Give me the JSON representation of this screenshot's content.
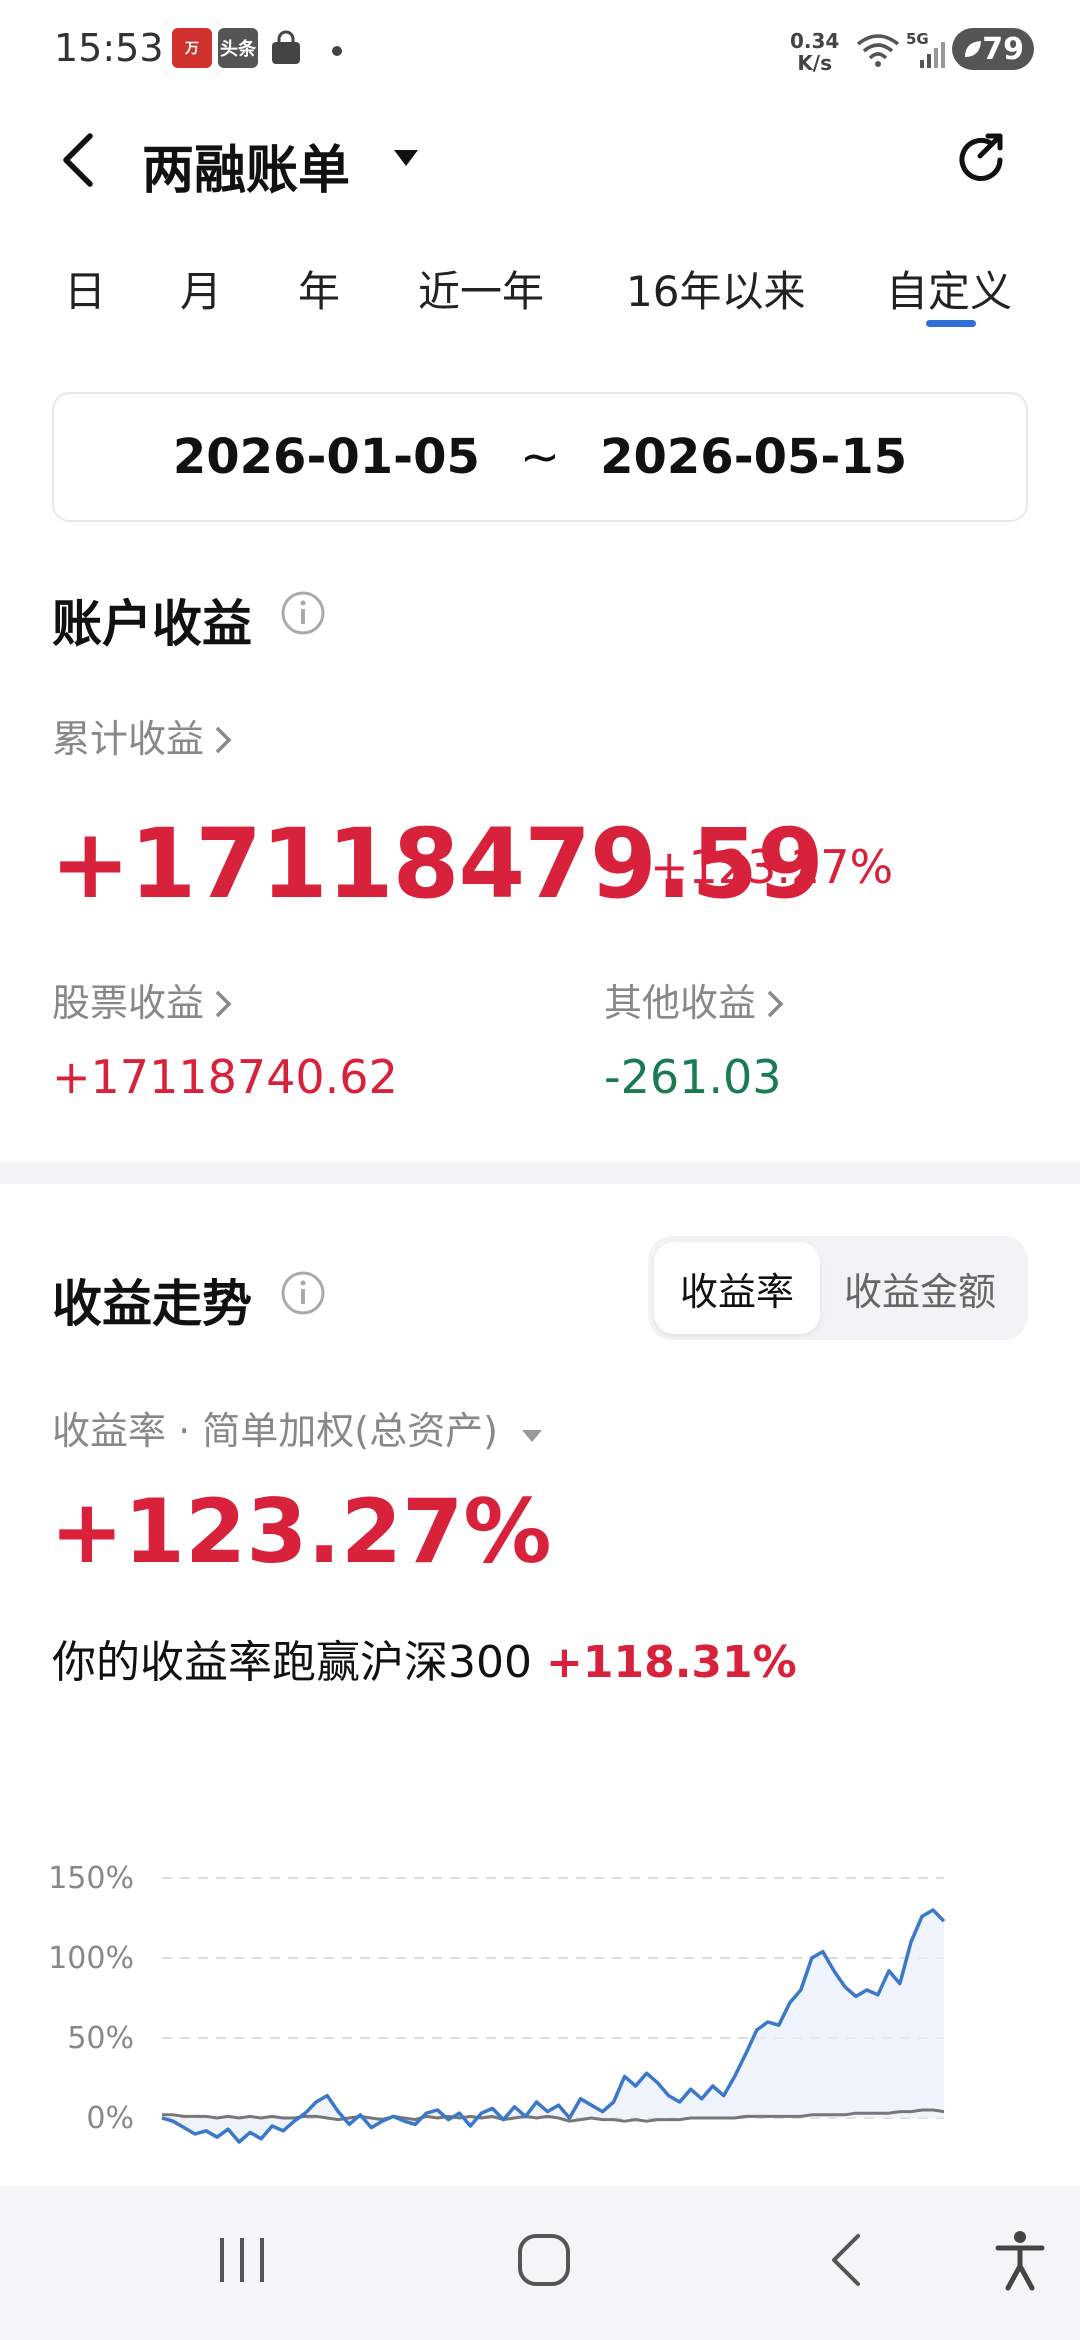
{
  "status_bar": {
    "time": "15:53",
    "app1": "万",
    "app2": "头条",
    "speed_top": "0.34",
    "speed_bottom": "K/s",
    "network": "5G",
    "battery": "79"
  },
  "header": {
    "title": "两融账单"
  },
  "tabs": [
    {
      "label": "日"
    },
    {
      "label": "月"
    },
    {
      "label": "年"
    },
    {
      "label": "近一年"
    },
    {
      "label": "16年以来"
    },
    {
      "label": "自定义",
      "active": true
    }
  ],
  "date_range": {
    "start": "2026-01-05",
    "separator": "~",
    "end": "2026-05-15"
  },
  "account_income": {
    "title": "账户收益",
    "cumulative_label": "累计收益",
    "cumulative_value": "+17118479.59",
    "cumulative_rate": "+123.27%",
    "stock_label": "股票收益",
    "stock_value": "+17118740.62",
    "other_label": "其他收益",
    "other_value": "-261.03"
  },
  "trend": {
    "title": "收益走势",
    "seg_rate": "收益率",
    "seg_amount": "收益金额",
    "method": "收益率 · 简单加权(总资产)",
    "rate_value": "+123.27%",
    "beat_text": "你的收益率跑赢沪深300",
    "beat_value": "+118.31%"
  },
  "colors": {
    "profit_red": "#d8213a",
    "loss_green": "#1a7a52",
    "accent_blue": "#2f6fd8",
    "benchmark_gray": "#777777"
  },
  "chart_data": {
    "type": "line",
    "y_ticks": [
      "150%",
      "100%",
      "50%",
      "0%"
    ],
    "ylim": [
      -20,
      150
    ],
    "grid": true,
    "series": [
      {
        "values": [
          0,
          -2,
          -6,
          -10,
          -8,
          -12,
          -7,
          -15,
          -9,
          -13,
          -5,
          -8,
          -2,
          3,
          10,
          14,
          4,
          -4,
          2,
          -6,
          -2,
          1,
          -2,
          -4,
          3,
          5,
          -1,
          3,
          -5,
          3,
          6,
          -1,
          7,
          1,
          10,
          4,
          8,
          0,
          12,
          8,
          4,
          10,
          26,
          20,
          28,
          22,
          14,
          10,
          18,
          12,
          20,
          14,
          26,
          40,
          55,
          60,
          58,
          72,
          80,
          100,
          104,
          92,
          82,
          76,
          80,
          77,
          92,
          84,
          110,
          126,
          130,
          123
        ]
      },
      {
        "values": [
          2,
          2,
          1,
          1,
          1,
          0,
          1,
          0,
          1,
          0,
          1,
          0,
          0,
          1,
          1,
          0,
          -1,
          0,
          1,
          0,
          -1,
          1,
          0,
          -1,
          1,
          0,
          1,
          0,
          1,
          0,
          1,
          -1,
          0,
          1,
          0,
          1,
          0,
          -2,
          -1,
          0,
          -1,
          -1,
          -2,
          -1,
          -2,
          -1,
          -1,
          -1,
          0,
          0,
          0,
          0,
          0,
          1,
          1,
          1,
          1,
          1,
          1,
          2,
          2,
          2,
          2,
          3,
          3,
          3,
          3,
          4,
          4,
          5,
          5,
          4
        ]
      }
    ]
  }
}
